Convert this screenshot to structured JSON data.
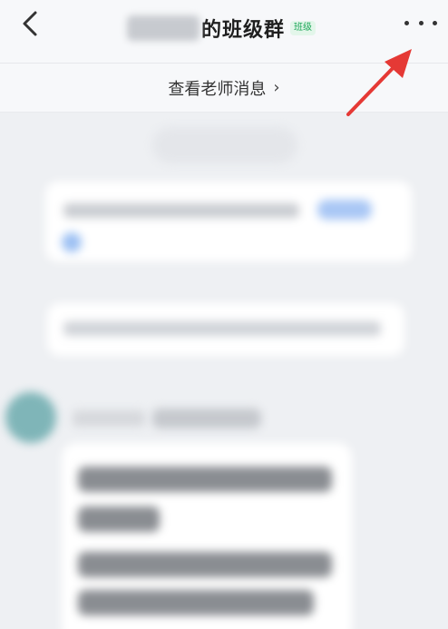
{
  "header": {
    "title_suffix": "的班级群",
    "tag": "班级"
  },
  "teacher_bar": {
    "label": "查看老师消息",
    "chevron": "›"
  },
  "icons": {
    "back": "chevron-left-icon",
    "more": "more-horizontal-icon",
    "arrow": "red-pointer-arrow"
  },
  "colors": {
    "accent_green": "#1fa85a",
    "annotation_red": "#e53935"
  }
}
